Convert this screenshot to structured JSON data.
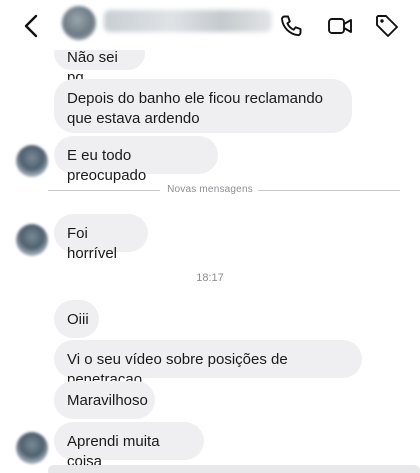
{
  "header": {
    "contact_name": "",
    "icons": [
      "back-chevron-icon",
      "phone-icon",
      "video-camera-icon",
      "tag-icon"
    ]
  },
  "messages": [
    {
      "text": "Não sei pq"
    },
    {
      "text": "Depois do banho ele ficou reclamando que estava ardendo"
    },
    {
      "text": "E eu todo preocupado"
    },
    {
      "text": "Foi horrível"
    },
    {
      "text": "Oiii"
    },
    {
      "text": "Vi o seu vídeo sobre posições de penetracao"
    },
    {
      "text": "Maravilhoso"
    },
    {
      "text": "Aprendi muita coisa"
    }
  ],
  "divider_label": "Novas mensagens",
  "timestamp": "18:17",
  "colors": {
    "bubble_bg": "#efeff1",
    "background": "#ffffff",
    "meta_text": "#8e8e93"
  }
}
